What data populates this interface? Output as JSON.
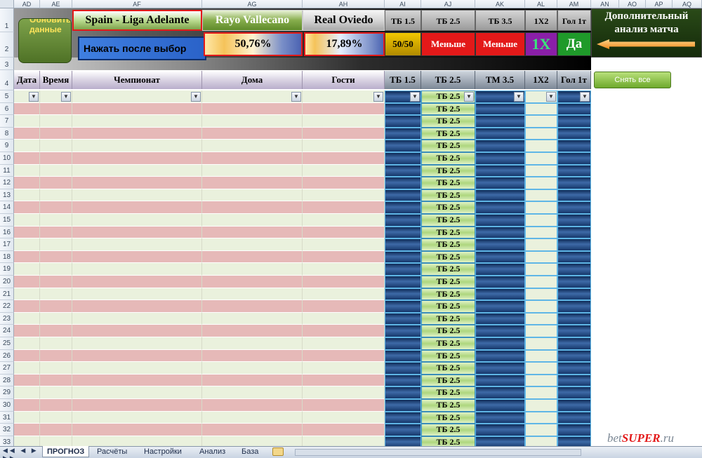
{
  "columns": [
    "AD",
    "AE",
    "AF",
    "AG",
    "AH",
    "AI",
    "AJ",
    "AK",
    "AL",
    "AM",
    "AN",
    "AO",
    "AP",
    "AQ"
  ],
  "rows": [
    "1",
    "2",
    "3",
    "4",
    "5",
    "6",
    "7",
    "8",
    "9",
    "10",
    "11",
    "12",
    "13",
    "14",
    "15",
    "16",
    "17",
    "18",
    "19",
    "20",
    "21",
    "22",
    "23",
    "24",
    "25",
    "26",
    "27",
    "28",
    "29",
    "30",
    "31",
    "32",
    "33"
  ],
  "top": {
    "refresh_button": "Обновить данные",
    "league": "Spain - Liga Adelante",
    "home_team": "Rayo Vallecano",
    "away_team": "Real Oviedo",
    "press_after_select": "Нажать после выбор",
    "home_pct": "50,76%",
    "away_pct": "17,89%",
    "headers": [
      "ТБ 1.5",
      "ТБ 2.5",
      "ТБ 3.5",
      "1X2",
      "Гол 1т"
    ],
    "values": [
      "50/50",
      "Меньше",
      "Меньше",
      "1X",
      "Да"
    ],
    "extra_analysis": "Дополнительный анализ матча"
  },
  "table_headers": [
    "Дата",
    "Время",
    "Чемпионат",
    "Дома",
    "Гости",
    "ТБ 1.5",
    "ТБ 2.5",
    "ТМ 3.5",
    "1X2",
    "Гол 1т"
  ],
  "clear_all_button": "Снять все",
  "filter_value": "ТБ 2.5",
  "tb25_value": "ТБ 2.5",
  "tabs": [
    "ПРОГНОЗ",
    "Расчёты",
    "Настройки",
    "Анализ",
    "База"
  ],
  "watermark": "betSUPER.ru",
  "colors": {
    "green_row": "#eaf1dd",
    "pink_row": "#e6b9b8",
    "blue_cell": "#2a5590",
    "tb_cell": "#c3e59c",
    "accent_red": "#e31919"
  }
}
